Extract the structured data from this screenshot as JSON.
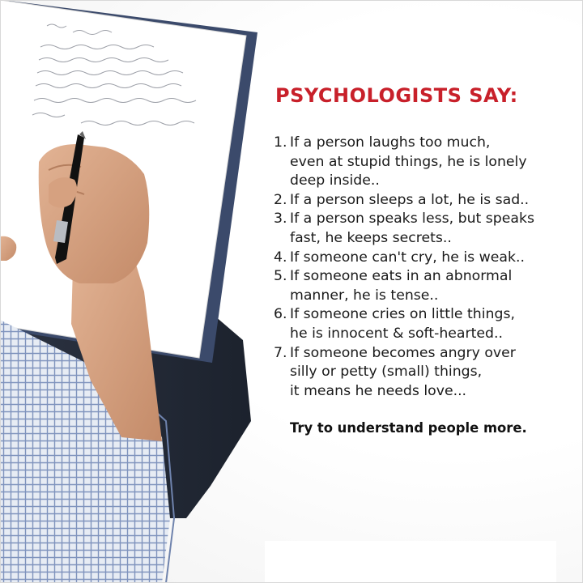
{
  "heading": "PSYCHOLOGISTS SAY:",
  "items": [
    {
      "number": "1.",
      "text": "If a person laughs too much,\neven at stupid things, he is lonely\ndeep inside.."
    },
    {
      "number": "2.",
      "text": "If a person sleeps a lot, he is sad.."
    },
    {
      "number": "3.",
      "text": "If a person speaks less, but speaks\nfast, he keeps secrets.."
    },
    {
      "number": "4.",
      "text": "If someone can't cry, he is weak.."
    },
    {
      "number": "5.",
      "text": "If someone eats in an abnormal\nmanner, he is tense.."
    },
    {
      "number": "6.",
      "text": "If someone cries on little things,\nhe is innocent & soft-hearted.."
    },
    {
      "number": "7.",
      "text": "If someone becomes angry over\nsilly or petty (small) things,\nit means he needs love..."
    }
  ],
  "closing": "Try to understand people more.",
  "colors": {
    "heading": "#c8202a",
    "body_text": "#1a1a1a",
    "shirt": "#9fb0d0",
    "skin": "#d9a583",
    "paper": "#ffffff",
    "notebook": "#3b4a6b"
  },
  "illustration": "hand-writing-on-notebook-photo"
}
